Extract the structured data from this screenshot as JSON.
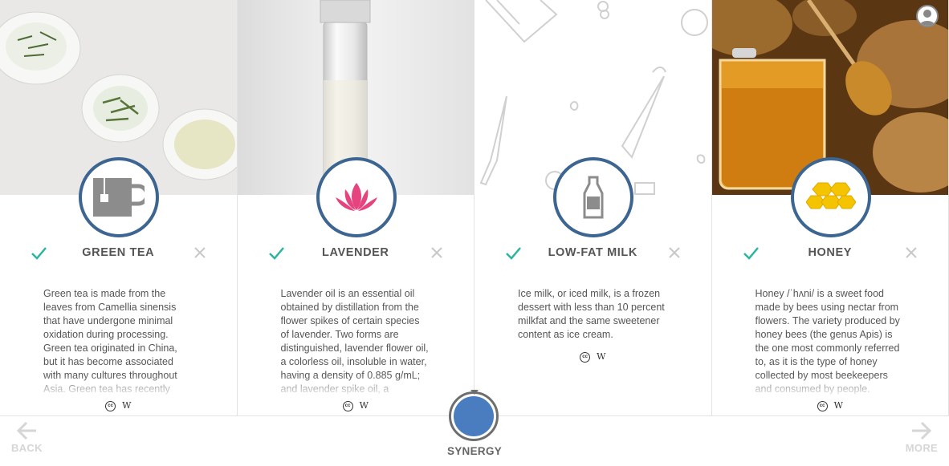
{
  "cards": [
    {
      "title": "GREEN TEA",
      "icon": "mug-icon",
      "description": "Green tea is made from the leaves from Camellia sinensis that have undergone minimal oxidation during processing. Green tea originated in China, but it has become associated with many cultures throughout Asia. Green tea has recently",
      "license_cc": "cc",
      "license_w": "W"
    },
    {
      "title": "LAVENDER",
      "icon": "lotus-icon",
      "description": "Lavender oil is an essential oil obtained by distillation from the flower spikes of certain species of lavender. Two forms are distinguished, lavender flower oil, a colorless oil, insoluble in water, having a density of 0.885 g/mL; and lavender spike oil, a",
      "license_cc": "cc",
      "license_w": "W"
    },
    {
      "title": "LOW-FAT MILK",
      "icon": "milk-bottle-icon",
      "description": "Ice milk, or iced milk, is a frozen dessert with less than 10 percent milkfat and the same sweetener content as ice cream.",
      "license_cc": "cc",
      "license_w": "W"
    },
    {
      "title": "HONEY",
      "icon": "honeycomb-icon",
      "description": "Honey /ˈhʌni/ is a sweet food made by bees using nectar from flowers. The variety produced by honey bees (the genus Apis) is the one most commonly referred to, as it is the type of honey collected by most beekeepers and consumed by people.",
      "license_cc": "cc",
      "license_w": "W"
    }
  ],
  "nav": {
    "back_label": "BACK",
    "more_label": "MORE",
    "synergy_label": "SYNERGY"
  },
  "colors": {
    "accent_ring": "#3d6592",
    "check": "#2bb5a0",
    "synergy": "#4a7cc0",
    "lotus": "#e6447f",
    "honeycomb": "#f5c400"
  }
}
